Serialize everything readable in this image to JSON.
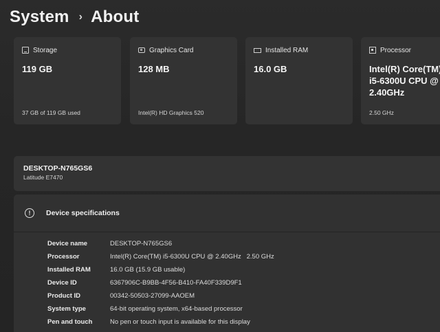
{
  "header": {
    "parent": "System",
    "separator": "›",
    "title": "About"
  },
  "cards": {
    "storage": {
      "label": "Storage",
      "value": "119 GB",
      "sub": "37 GB of 119 GB used",
      "icon": "storage-icon"
    },
    "graphics": {
      "label": "Graphics Card",
      "value": "128 MB",
      "sub": "Intel(R) HD Graphics 520",
      "icon": "graphics-card-icon"
    },
    "ram": {
      "label": "Installed RAM",
      "value": "16.0 GB",
      "sub": "",
      "icon": "ram-icon"
    },
    "processor": {
      "label": "Processor",
      "value": "Intel(R) Core(TM) i5-6300U CPU @ 2.40GHz",
      "sub": "2.50 GHz",
      "icon": "processor-icon"
    }
  },
  "device": {
    "name": "DESKTOP-N765GS6",
    "model": "Latitude E7470"
  },
  "specs": {
    "title": "Device specifications",
    "icon": "info-icon",
    "rows": [
      {
        "label": "Device name",
        "value": "DESKTOP-N765GS6"
      },
      {
        "label": "Processor",
        "value": "Intel(R) Core(TM) i5-6300U CPU @ 2.40GHz   2.50 GHz"
      },
      {
        "label": "Installed RAM",
        "value": "16.0 GB (15.9 GB usable)"
      },
      {
        "label": "Device ID",
        "value": "6367906C-B9BB-4F56-B410-FA40F339D9F1"
      },
      {
        "label": "Product ID",
        "value": "00342-50503-27099-AAOEM"
      },
      {
        "label": "System type",
        "value": "64-bit operating system, x64-based processor"
      },
      {
        "label": "Pen and touch",
        "value": "No pen or touch input is available for this display"
      }
    ]
  }
}
